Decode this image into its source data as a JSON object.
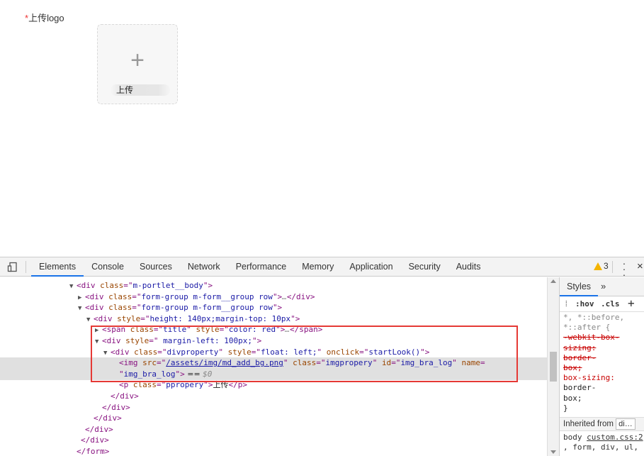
{
  "form": {
    "required_mark": "*",
    "label": "上传logo",
    "upload_plus": "+",
    "upload_caption": "上传"
  },
  "devtools": {
    "tabs": [
      "Elements",
      "Console",
      "Sources",
      "Network",
      "Performance",
      "Memory",
      "Application",
      "Security",
      "Audits"
    ],
    "active_tab": "Elements",
    "warning_count": "3",
    "styles_tab": "Styles",
    "styles_more": "»",
    "filter_hov": ":hov",
    "filter_cls": ".cls",
    "filter_add": "+",
    "dom": [
      {
        "indent": 0,
        "arrow": "▼",
        "parts": [
          [
            "tag",
            "<div "
          ],
          [
            "attr",
            "class"
          ],
          [
            "tag",
            "=\""
          ],
          [
            "val",
            "m-portlet__body"
          ],
          [
            "tag",
            "\">"
          ]
        ]
      },
      {
        "indent": 1,
        "arrow": "▶",
        "parts": [
          [
            "tag",
            "<div "
          ],
          [
            "attr",
            "class"
          ],
          [
            "tag",
            "=\""
          ],
          [
            "val",
            "form-group m-form__group row"
          ],
          [
            "tag",
            "\">"
          ],
          [
            "dim",
            "…"
          ],
          [
            "tag",
            "</div>"
          ]
        ]
      },
      {
        "indent": 1,
        "arrow": "▼",
        "parts": [
          [
            "tag",
            "<div "
          ],
          [
            "attr",
            "class"
          ],
          [
            "tag",
            "=\""
          ],
          [
            "val",
            "form-group m-form__group row"
          ],
          [
            "tag",
            "\">"
          ]
        ]
      },
      {
        "indent": 2,
        "arrow": "▼",
        "parts": [
          [
            "tag",
            "<div "
          ],
          [
            "attr",
            "style"
          ],
          [
            "tag",
            "=\""
          ],
          [
            "val",
            "height: 140px;margin-top: 10px"
          ],
          [
            "tag",
            "\">"
          ]
        ]
      },
      {
        "indent": 3,
        "arrow": "▶",
        "parts": [
          [
            "tag",
            "<span "
          ],
          [
            "attr",
            "class"
          ],
          [
            "tag",
            "=\""
          ],
          [
            "val",
            "title"
          ],
          [
            "tag",
            "\" "
          ],
          [
            "attr",
            "style"
          ],
          [
            "tag",
            "=\""
          ],
          [
            "val",
            "color: red"
          ],
          [
            "tag",
            "\">"
          ],
          [
            "dim",
            "…"
          ],
          [
            "tag",
            "</span>"
          ]
        ]
      },
      {
        "indent": 3,
        "arrow": "▼",
        "parts": [
          [
            "tag",
            "<div "
          ],
          [
            "attr",
            "style"
          ],
          [
            "tag",
            "=\""
          ],
          [
            "val",
            "  margin-left: 100px;"
          ],
          [
            "tag",
            "\">"
          ]
        ]
      },
      {
        "indent": 4,
        "arrow": "▼",
        "parts": [
          [
            "tag",
            "<div "
          ],
          [
            "attr",
            "class"
          ],
          [
            "tag",
            "=\""
          ],
          [
            "val",
            "divproperty"
          ],
          [
            "tag",
            "\" "
          ],
          [
            "attr",
            "style"
          ],
          [
            "tag",
            "=\""
          ],
          [
            "val",
            "float: left;"
          ],
          [
            "tag",
            "\" "
          ],
          [
            "attr",
            "onclick"
          ],
          [
            "tag",
            "=\""
          ],
          [
            "val",
            "startLook()"
          ],
          [
            "tag",
            "\">"
          ]
        ]
      },
      {
        "indent": 5,
        "arrow": "",
        "sel": true,
        "parts": [
          [
            "tag",
            "<img "
          ],
          [
            "attr",
            "src"
          ],
          [
            "tag",
            "=\""
          ],
          [
            "link",
            "/assets/img/md_add_bg.png"
          ],
          [
            "tag",
            "\" "
          ],
          [
            "attr",
            "class"
          ],
          [
            "tag",
            "=\""
          ],
          [
            "val",
            "imgpropery"
          ],
          [
            "tag",
            "\" "
          ],
          [
            "attr",
            "id"
          ],
          [
            "tag",
            "=\""
          ],
          [
            "val",
            "img_bra_log"
          ],
          [
            "tag",
            "\" "
          ],
          [
            "attr",
            "name"
          ],
          [
            "tag",
            "="
          ]
        ]
      },
      {
        "indent": 5,
        "arrow": "",
        "sel": true,
        "parts": [
          [
            "tag",
            "\""
          ],
          [
            "val",
            "img_bra_log"
          ],
          [
            "tag",
            "\">"
          ],
          [
            "txt",
            " == "
          ],
          [
            "dim",
            "$0"
          ]
        ]
      },
      {
        "indent": 5,
        "arrow": "",
        "parts": [
          [
            "tag",
            "<p "
          ],
          [
            "attr",
            "class"
          ],
          [
            "tag",
            "=\""
          ],
          [
            "val",
            "ppropery"
          ],
          [
            "tag",
            "\">"
          ],
          [
            "txt",
            "上传"
          ],
          [
            "tag",
            "</p>"
          ]
        ]
      },
      {
        "indent": 4,
        "arrow": "",
        "parts": [
          [
            "tag",
            "</div>"
          ]
        ]
      },
      {
        "indent": 3,
        "arrow": "",
        "parts": [
          [
            "tag",
            "</div>"
          ]
        ]
      },
      {
        "indent": 2,
        "arrow": "",
        "parts": [
          [
            "tag",
            "</div>"
          ]
        ]
      },
      {
        "indent": 1,
        "arrow": "",
        "parts": [
          [
            "tag",
            "</div>"
          ]
        ]
      },
      {
        "indent": 0.5,
        "arrow": "",
        "parts": [
          [
            "tag",
            "</div>"
          ]
        ]
      },
      {
        "indent": 0,
        "arrow": "",
        "parts": [
          [
            "tag",
            "</form>"
          ]
        ]
      }
    ],
    "styles_rules": [
      {
        "cls": "sel",
        "text": "*, *::before,"
      },
      {
        "cls": "sel",
        "text": "*::after {"
      },
      {
        "cls": "prop-strike",
        "text": "  -webkit-box-"
      },
      {
        "cls": "prop-strike",
        "text": "    sizing:"
      },
      {
        "cls": "prop-strike",
        "text": "    border-"
      },
      {
        "cls": "prop-strike",
        "text": "    box;"
      },
      {
        "cls": "prop",
        "text": "  box-sizing:"
      },
      {
        "cls": "pv",
        "text": "    border-"
      },
      {
        "cls": "pv",
        "text": "    box;"
      },
      {
        "cls": "pv",
        "text": "}"
      }
    ],
    "inherited_label": "Inherited from",
    "inherited_value": "di…",
    "source_prefix": "body ",
    "source_link": "custom.css:2",
    "last_line": ", form, div, ul,"
  }
}
